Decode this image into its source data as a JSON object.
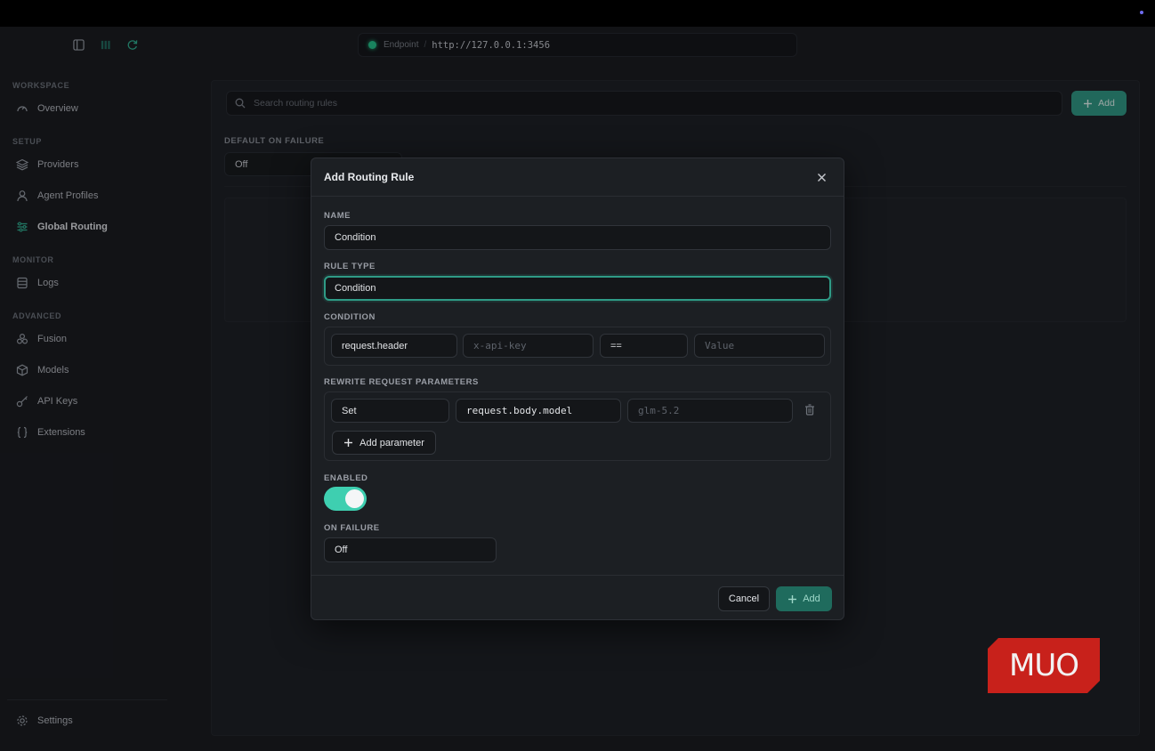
{
  "endpoint": {
    "label": "Endpoint",
    "separator": "/",
    "url": "http://127.0.0.1:3456"
  },
  "sidebar": {
    "sections": {
      "workspace": "WORKSPACE",
      "setup": "SETUP",
      "monitor": "MONITOR",
      "advanced": "ADVANCED"
    },
    "items": [
      {
        "label": "Overview",
        "icon": "gauge-icon"
      },
      {
        "label": "Providers",
        "icon": "layers-icon"
      },
      {
        "label": "Agent Profiles",
        "icon": "user-icon"
      },
      {
        "label": "Global Routing",
        "icon": "routing-icon",
        "active": true
      },
      {
        "label": "Logs",
        "icon": "database-icon"
      },
      {
        "label": "Fusion",
        "icon": "fusion-icon"
      },
      {
        "label": "Models",
        "icon": "cube-icon"
      },
      {
        "label": "API Keys",
        "icon": "key-icon"
      },
      {
        "label": "Extensions",
        "icon": "braces-icon"
      },
      {
        "label": "Settings",
        "icon": "gear-icon"
      }
    ]
  },
  "main": {
    "search_placeholder": "Search routing rules",
    "add_label": "Add",
    "default_on_failure_label": "DEFAULT ON FAILURE",
    "default_on_failure_value": "Off"
  },
  "modal": {
    "title": "Add Routing Rule",
    "name_label": "NAME",
    "name_value": "Condition",
    "rule_type_label": "RULE TYPE",
    "rule_type_value": "Condition",
    "condition_label": "CONDITION",
    "condition": {
      "source": "request.header",
      "key_placeholder": "x-api-key",
      "operator": "==",
      "value_placeholder": "Value"
    },
    "rewrite_label": "REWRITE REQUEST PARAMETERS",
    "rewrite": {
      "action": "Set",
      "path": "request.body.model",
      "value_placeholder": "glm-5.2"
    },
    "add_parameter_label": "Add parameter",
    "enabled_label": "ENABLED",
    "enabled": true,
    "on_failure_label": "ON FAILURE",
    "on_failure_value": "Off",
    "cancel_label": "Cancel",
    "submit_label": "Add"
  },
  "watermark": {
    "text": "MUO"
  },
  "colors": {
    "accent": "#2f9b86",
    "toggle_on": "#3ecfb0",
    "status_dot": "#22c58b",
    "logo_red": "#c8211b"
  }
}
